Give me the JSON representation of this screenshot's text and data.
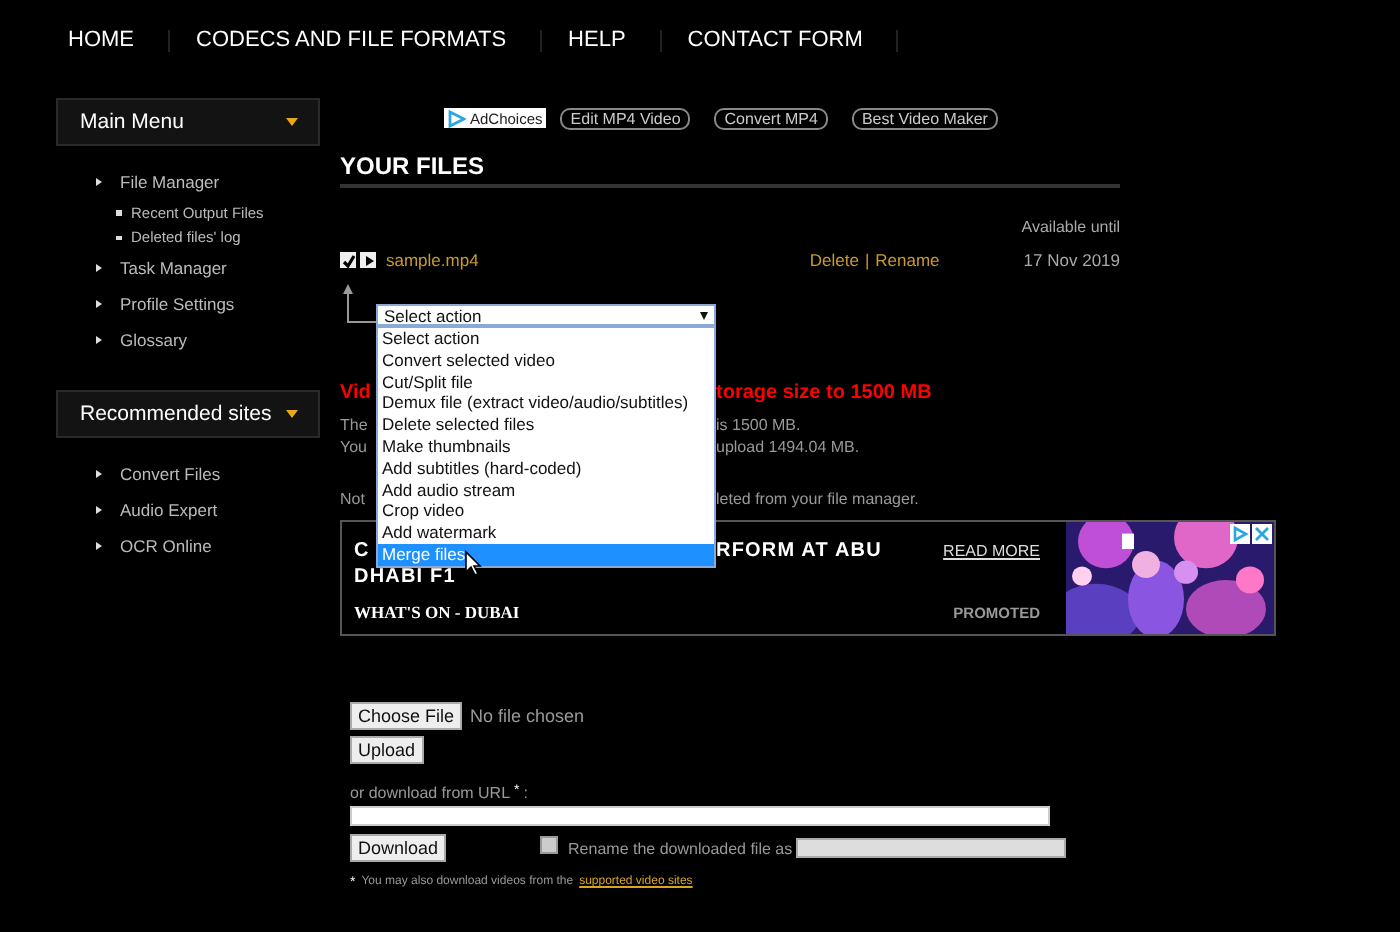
{
  "nav": [
    {
      "label": "HOME"
    },
    {
      "label": "CODECS AND FILE FORMATS"
    },
    {
      "label": "HELP"
    },
    {
      "label": "CONTACT FORM"
    }
  ],
  "ad_links": [
    {
      "label": "AdChoices",
      "kind": "adchoices"
    },
    {
      "label": "Edit MP4 Video",
      "kind": "pill"
    },
    {
      "label": "Convert MP4",
      "kind": "pill"
    },
    {
      "label": "Best Video Maker",
      "kind": "pill"
    }
  ],
  "sidebar": [
    {
      "title": "Main Menu",
      "items": [
        {
          "label": "File Manager",
          "children": [
            {
              "label": "Recent Output Files"
            },
            {
              "label": "Deleted files' log"
            }
          ]
        },
        {
          "label": "Task Manager"
        },
        {
          "label": "Profile Settings"
        },
        {
          "label": "Glossary"
        }
      ]
    },
    {
      "title": "Recommended sites",
      "items": [
        {
          "label": "Convert Files"
        },
        {
          "label": "Audio Expert"
        },
        {
          "label": "OCR Online"
        }
      ]
    }
  ],
  "files": {
    "title": "YOUR FILES",
    "column_header": "Available until",
    "rows": [
      {
        "checked": true,
        "name": "sample.mp4",
        "actions": [
          "Delete",
          "Rename"
        ],
        "separator": "|",
        "date": "17 Nov 2019"
      }
    ]
  },
  "action_select": {
    "value": "Select action",
    "expanded": true,
    "options": [
      {
        "label": "Select action",
        "highlighted": false
      },
      {
        "label": "Convert selected video",
        "highlighted": false
      },
      {
        "label": "Cut/Split file",
        "highlighted": false
      },
      {
        "label": "Demux file (extract video/audio/subtitles)",
        "highlighted": false
      },
      {
        "label": "Delete selected files",
        "highlighted": false
      },
      {
        "label": "Make thumbnails",
        "highlighted": false
      },
      {
        "label": "Add subtitles (hard-coded)",
        "highlighted": false
      },
      {
        "label": "Add audio stream",
        "highlighted": false
      },
      {
        "label": "Crop video",
        "highlighted": false
      },
      {
        "label": "Add watermark",
        "highlighted": false
      },
      {
        "label": "Merge files",
        "highlighted": true
      }
    ]
  },
  "notices": [
    {
      "kind": "warning",
      "left": "Vid",
      "right": "torage size to 1500 MB"
    },
    {
      "kind": "info",
      "left": "The",
      "right": "is 1500 MB."
    },
    {
      "kind": "info",
      "left": "You",
      "right": "upload 1494.04 MB."
    },
    {
      "kind": "note",
      "left": "Not",
      "right": "leted from your file manager."
    }
  ],
  "ad": {
    "headline_left": "C",
    "headline_right": "RFORM AT ABU",
    "headline_line2": "DHABI F1",
    "read_more": "READ MORE",
    "source": "WHAT'S ON - DUBAI",
    "label": "PROMOTED"
  },
  "upload": {
    "choose_button": "Choose File",
    "file_status": "No file chosen",
    "upload_button": "Upload",
    "url_label": "or download from URL",
    "required_mark": "*",
    "url_label_suffix": ":",
    "download_button": "Download",
    "rename": {
      "checked": false,
      "label": "Rename the downloaded file as"
    },
    "footnote_mark": "*",
    "footnote": "You may also download videos from the",
    "footnote_link": "supported video sites"
  }
}
